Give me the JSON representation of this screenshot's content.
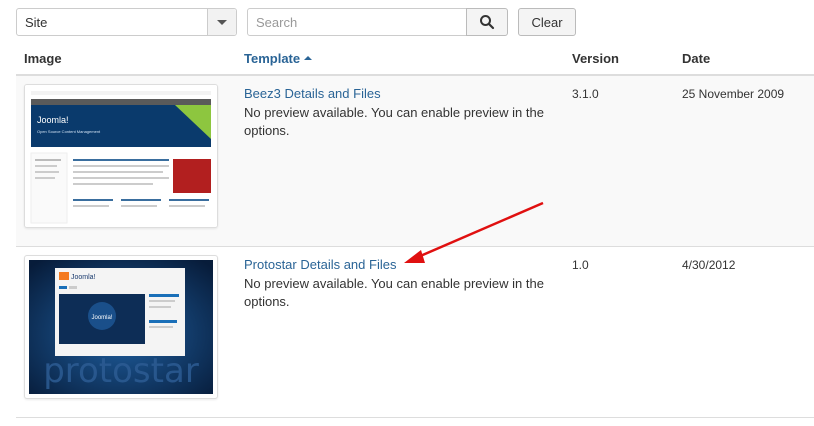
{
  "filter": {
    "client_value": "Site",
    "search_placeholder": "Search",
    "clear_label": "Clear"
  },
  "table": {
    "headers": {
      "image": "Image",
      "template": "Template",
      "version": "Version",
      "date": "Date"
    },
    "rows": [
      {
        "link": "Beez3 Details and Files",
        "description": "No preview available. You can enable preview in the options.",
        "version": "3.1.0",
        "date": "25 November 2009",
        "thumb": {
          "logo": "Joomla!",
          "tagline": "Open Source Content Management",
          "accent": "#003a6c"
        }
      },
      {
        "link": "Protostar Details and Files",
        "description": "No preview available. You can enable preview in the options.",
        "version": "1.0",
        "date": "4/30/2012",
        "thumb": {
          "wordmark": "protostar",
          "logo": "Joomla!",
          "accent": "#0b2a52"
        }
      }
    ]
  },
  "colors": {
    "link": "#2a6496",
    "annotation_arrow": "#e01010",
    "border": "#dddddd"
  },
  "icons": {
    "search": "search-icon",
    "dropdown": "chevron-down-icon"
  }
}
